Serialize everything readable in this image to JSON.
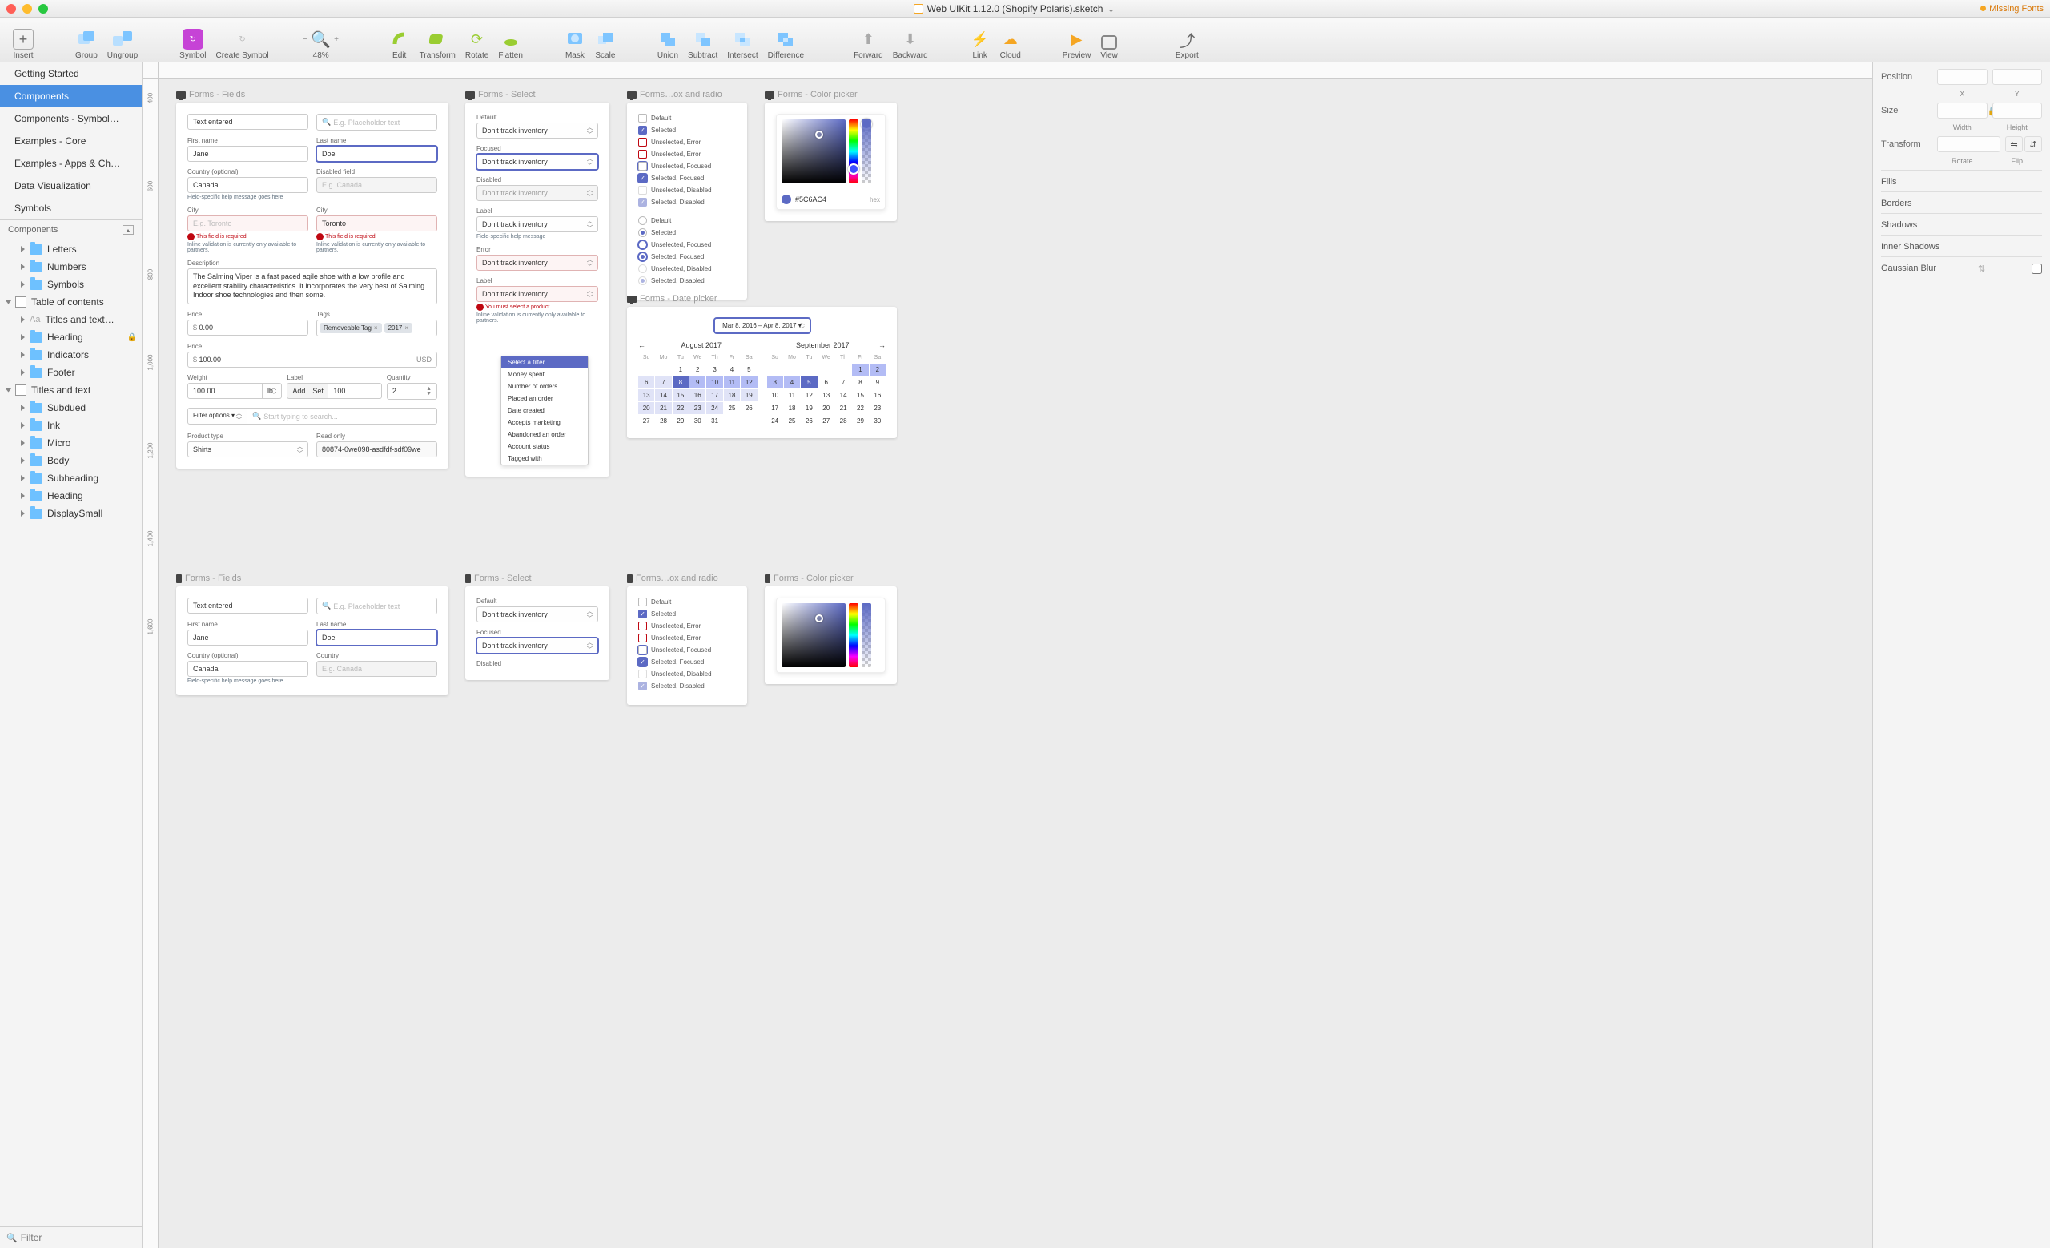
{
  "titlebar": {
    "filename": "Web UIKit 1.12.0 (Shopify Polaris).sketch",
    "chevron": "⌄",
    "missing_fonts": "Missing Fonts"
  },
  "toolbar": {
    "insert": "Insert",
    "group": "Group",
    "ungroup": "Ungroup",
    "symbol": "Symbol",
    "create_symbol": "Create Symbol",
    "zoom_level": "48%",
    "edit": "Edit",
    "transform": "Transform",
    "rotate": "Rotate",
    "flatten": "Flatten",
    "mask": "Mask",
    "scale": "Scale",
    "union": "Union",
    "subtract": "Subtract",
    "intersect": "Intersect",
    "difference": "Difference",
    "forward": "Forward",
    "backward": "Backward",
    "link": "Link",
    "cloud": "Cloud",
    "preview": "Preview",
    "view": "View",
    "export": "Export"
  },
  "pages": {
    "items": [
      "Getting Started",
      "Components",
      "Components - Symbol…",
      "Examples - Core",
      "Examples - Apps & Ch…",
      "Data Visualization",
      "Symbols"
    ],
    "active": 1
  },
  "layers_header": "Components",
  "layers": [
    {
      "indent": 1,
      "icon": "folder",
      "label": "Letters"
    },
    {
      "indent": 1,
      "icon": "folder",
      "label": "Numbers"
    },
    {
      "indent": 1,
      "icon": "folder",
      "label": "Symbols"
    },
    {
      "indent": 0,
      "icon": "artboard",
      "label": "Table of contents",
      "open": true
    },
    {
      "indent": 1,
      "icon": "text",
      "label": "Titles and text…"
    },
    {
      "indent": 1,
      "icon": "folder",
      "label": "Heading",
      "locked": true
    },
    {
      "indent": 1,
      "icon": "folder",
      "label": "Indicators"
    },
    {
      "indent": 1,
      "icon": "folder",
      "label": "Footer"
    },
    {
      "indent": 0,
      "icon": "artboard",
      "label": "Titles and text",
      "open": true
    },
    {
      "indent": 1,
      "icon": "folder",
      "label": "Subdued"
    },
    {
      "indent": 1,
      "icon": "folder",
      "label": "Ink"
    },
    {
      "indent": 1,
      "icon": "folder",
      "label": "Micro"
    },
    {
      "indent": 1,
      "icon": "folder",
      "label": "Body"
    },
    {
      "indent": 1,
      "icon": "folder",
      "label": "Subheading"
    },
    {
      "indent": 1,
      "icon": "folder",
      "label": "Heading"
    },
    {
      "indent": 1,
      "icon": "folder",
      "label": "DisplaySmall"
    }
  ],
  "filter_placeholder": "Filter",
  "ruler_v": [
    "400",
    "600",
    "800",
    "1,000",
    "1,200",
    "1,400",
    "1,600"
  ],
  "artboards": {
    "fields_title": "Forms - Fields",
    "select_title": "Forms - Select",
    "checkbox_title": "Forms…ox and radio",
    "color_title": "Forms - Color picker",
    "date_title": "Forms - Date picker"
  },
  "fields": {
    "text_entered": "Text entered",
    "placeholder_input": "E.g. Placeholder text",
    "first_name_label": "First name",
    "first_name_value": "Jane",
    "last_name_label": "Last name",
    "last_name_value": "Doe",
    "country_opt_label": "Country (optional)",
    "country_opt_value": "Canada",
    "disabled_label": "Disabled field",
    "disabled_placeholder": "E.g. Canada",
    "help_msg": "Field-specific help message goes here",
    "city_label": "City",
    "city_placeholder": "E.g. Toronto",
    "city_value": "Toronto",
    "required_err": "This field is required",
    "inline_err": "Inline validation is currently only available to partners.",
    "description_label": "Description",
    "description_text": "The Salming Viper is a fast paced agile shoe with a low profile and excellent stability characteristics. It incorporates the very best of Salming Indoor shoe technologies and then some.",
    "price_label": "Price",
    "price_prefix": "$",
    "price_value": "0.00",
    "tags_label": "Tags",
    "tag1": "Removeable Tag",
    "tag2": "2017",
    "price2_value": "100.00",
    "price2_suffix": "USD",
    "weight_label": "Weight",
    "weight_value": "100.00",
    "weight_unit": "lb",
    "label_label": "Label",
    "btn_add": "Add",
    "btn_set": "Set",
    "label_value": "100",
    "quantity_label": "Quantity",
    "quantity_value": "2",
    "filter_options": "Filter options",
    "filter_search": "Start typing to search...",
    "product_type_label": "Product type",
    "product_type_value": "Shirts",
    "readonly_label": "Read only",
    "readonly_value": "80874-0we098-asdfdf-sdf09we"
  },
  "select": {
    "default_label": "Default",
    "focused_label": "Focused",
    "disabled_label": "Disabled",
    "label_label": "Label",
    "error_label": "Error",
    "option": "Don't track inventory",
    "help": "Field-specific help message",
    "must_select": "You must select a product",
    "inline": "Inline validation is currently only available to partners.",
    "menu": [
      "Select a filter...",
      "Money spent",
      "Number of orders",
      "Placed an order",
      "Date created",
      "Accepts marketing",
      "Abandoned an order",
      "Account status",
      "Tagged with"
    ]
  },
  "checkbox": {
    "items": [
      "Default",
      "Selected",
      "Unselected, Error",
      "Unselected, Error",
      "Unselected, Focused",
      "Selected, Focused",
      "Unselected, Disabled",
      "Selected, Disabled"
    ],
    "radio": [
      "Default",
      "Selected",
      "Unselected, Focused",
      "Selected, Focused",
      "Unselected, Disabled",
      "Selected, Disabled"
    ]
  },
  "color": {
    "hex": "#5C6AC4",
    "hex_label": "hex"
  },
  "date": {
    "range": "Mar 8, 2016 – Apr 8, 2017",
    "month1": "August 2017",
    "month2": "September 2017",
    "weekdays": [
      "Su",
      "Mo",
      "Tu",
      "We",
      "Th",
      "Fr",
      "Sa"
    ],
    "m1_days": [
      [
        "",
        "",
        "1",
        "2",
        "3",
        "4",
        "5"
      ],
      [
        "6",
        "7",
        "8",
        "9",
        "10",
        "11",
        "12"
      ],
      [
        "13",
        "14",
        "15",
        "16",
        "17",
        "18",
        "19"
      ],
      [
        "20",
        "21",
        "22",
        "23",
        "24",
        "25",
        "26"
      ],
      [
        "27",
        "28",
        "29",
        "30",
        "31",
        "",
        ""
      ]
    ],
    "m2_days": [
      [
        "",
        "",
        "",
        "",
        "",
        "1",
        "2"
      ],
      [
        "3",
        "4",
        "5",
        "6",
        "7",
        "8",
        "9"
      ],
      [
        "10",
        "11",
        "12",
        "13",
        "14",
        "15",
        "16"
      ],
      [
        "17",
        "18",
        "19",
        "20",
        "21",
        "22",
        "23"
      ],
      [
        "24",
        "25",
        "26",
        "27",
        "28",
        "29",
        "30"
      ]
    ]
  },
  "inspector": {
    "position": "Position",
    "x": "X",
    "y": "Y",
    "size": "Size",
    "width": "Width",
    "height": "Height",
    "transform": "Transform",
    "rotate": "Rotate",
    "flip": "Flip",
    "fills": "Fills",
    "borders": "Borders",
    "shadows": "Shadows",
    "inner_shadows": "Inner Shadows",
    "gaussian": "Gaussian Blur"
  },
  "fields2": {
    "country_label": "Country",
    "country_placeholder": "E.g. Canada"
  }
}
